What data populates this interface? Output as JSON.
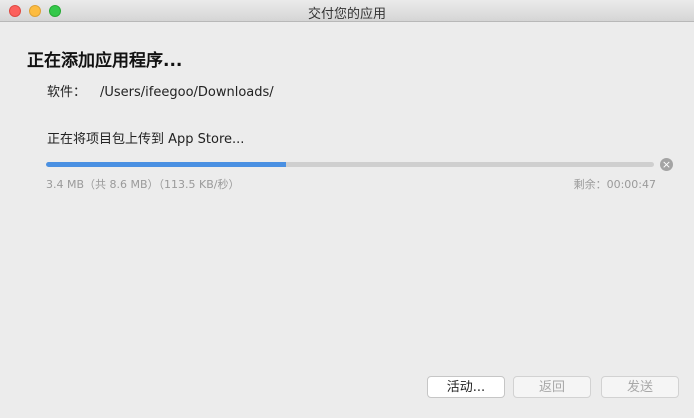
{
  "window": {
    "title": "交付您的应用"
  },
  "heading": "正在添加应用程序...",
  "app": {
    "label": "软件：",
    "path": "/Users/ifeegoo/Downloads/"
  },
  "status": "正在将项目包上传到 App Store...",
  "progress": {
    "fraction": 0.395,
    "size_text": "3.4 MB（共 8.6 MB）（113.5 KB/秒）",
    "remaining_text": "剩余：00:00:47"
  },
  "icons": {
    "cancel": "close-circle-icon"
  },
  "colors": {
    "accent": "#4a90e2",
    "close": "#fc605c",
    "minimize": "#fdbc40",
    "zoom": "#34c84a"
  },
  "buttons": {
    "activity": "活动...",
    "back": "返回",
    "send": "发送"
  }
}
